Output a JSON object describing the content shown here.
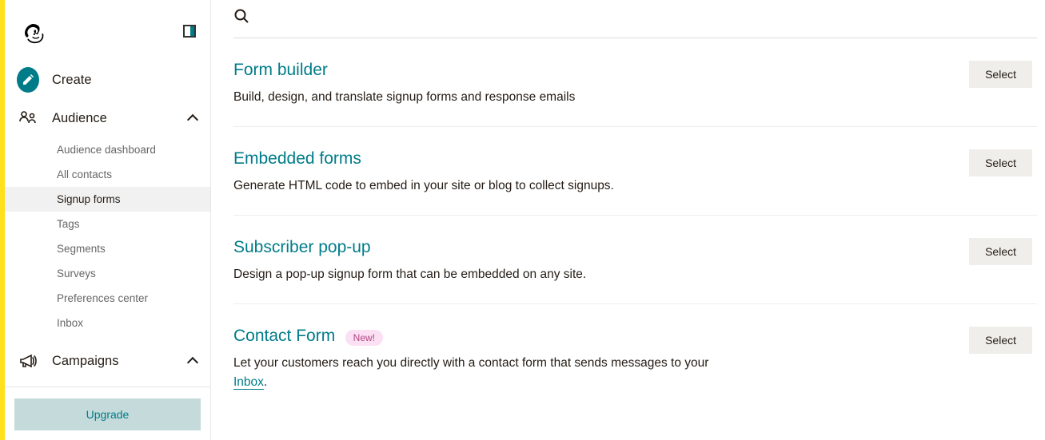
{
  "sidebar": {
    "create_label": "Create",
    "audience_label": "Audience",
    "audience_items": [
      "Audience dashboard",
      "All contacts",
      "Signup forms",
      "Tags",
      "Segments",
      "Surveys",
      "Preferences center",
      "Inbox"
    ],
    "campaigns_label": "Campaigns",
    "upgrade_label": "Upgrade"
  },
  "main": {
    "select_label": "Select",
    "options": [
      {
        "title": "Form builder",
        "desc": "Build, design, and translate signup forms and response emails",
        "badge": null
      },
      {
        "title": "Embedded forms",
        "desc": "Generate HTML code to embed in your site or blog to collect signups.",
        "badge": null
      },
      {
        "title": "Subscriber pop-up",
        "desc": "Design a pop-up signup form that can be embedded on any site.",
        "badge": null
      },
      {
        "title": "Contact Form",
        "desc_prefix": "Let your customers reach you directly with a contact form that sends messages to your ",
        "inbox_link": "Inbox",
        "desc_suffix": ".",
        "badge": "New!"
      }
    ]
  }
}
